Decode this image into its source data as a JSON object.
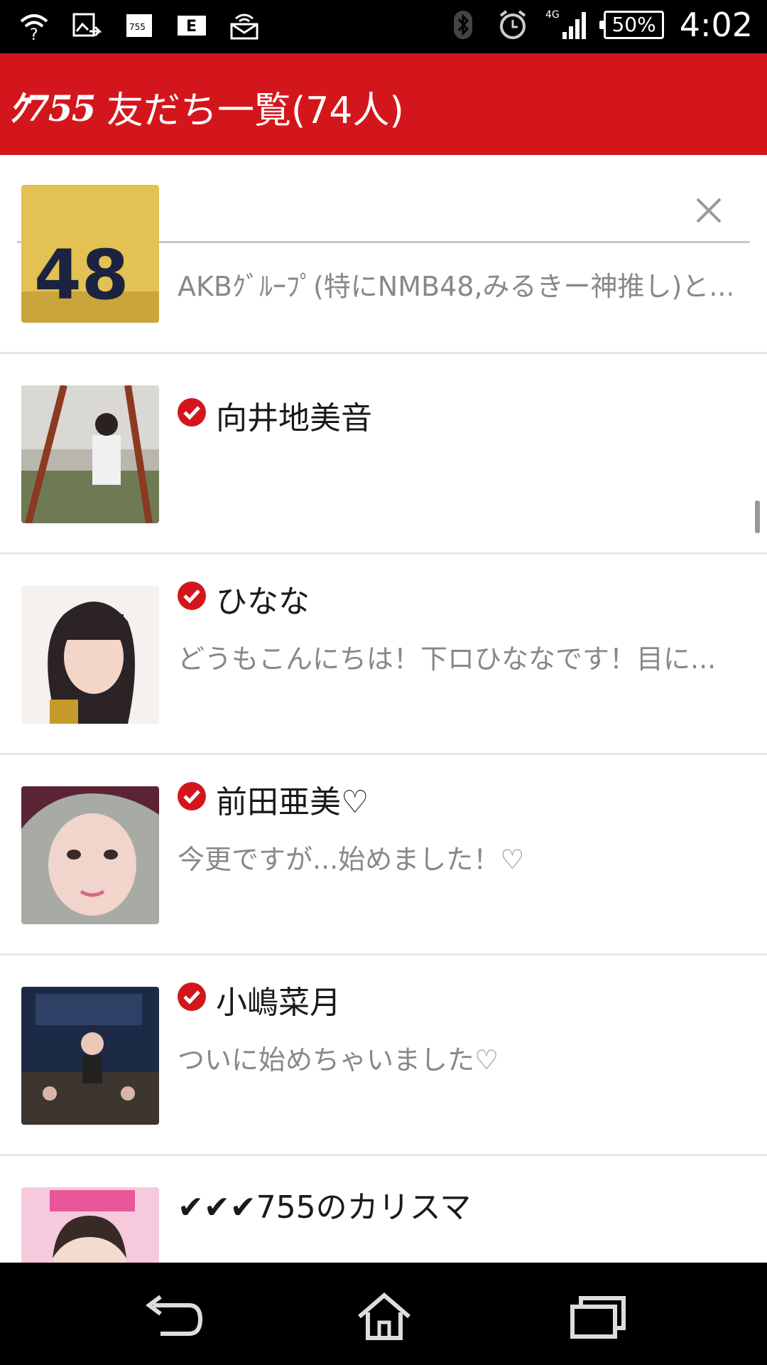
{
  "status_bar": {
    "battery": "50%",
    "time": "4:02",
    "network": "4G",
    "left_icons": [
      "wifi-question-icon",
      "image-share-icon",
      "755-notification-icon",
      "e-app-icon",
      "wifi-hotspot-icon"
    ],
    "right_icons": [
      "bluetooth-icon",
      "alarm-icon",
      "signal-icon"
    ]
  },
  "header": {
    "logo": "ｸ755",
    "title": "友だち一覧(74人)",
    "color": "#d3161c"
  },
  "search": {
    "placeholder": "",
    "value": ""
  },
  "friends": [
    {
      "name": "",
      "description": "AKBｸﾞﾙｰﾌﾟ(特にNMB48,みるきー神推し)と...",
      "verified": false,
      "avatar": "jersey-48"
    },
    {
      "name": "向井地美音",
      "description": "",
      "verified": true,
      "avatar": "girl-swing"
    },
    {
      "name": "ひなな",
      "description": "どうもこんにちは！下ロひななです！目に...",
      "verified": true,
      "avatar": "girl-bangs"
    },
    {
      "name": "前田亜美♡",
      "description": "今更ですが...始めました！♡",
      "verified": true,
      "avatar": "girl-purple-hair"
    },
    {
      "name": "小嶋菜月",
      "description": "ついに始めちゃいました♡",
      "verified": true,
      "avatar": "stage-show"
    },
    {
      "name": "✔✔✔755のカリスマ",
      "description": "",
      "verified": false,
      "avatar": "akb48-pink"
    }
  ]
}
